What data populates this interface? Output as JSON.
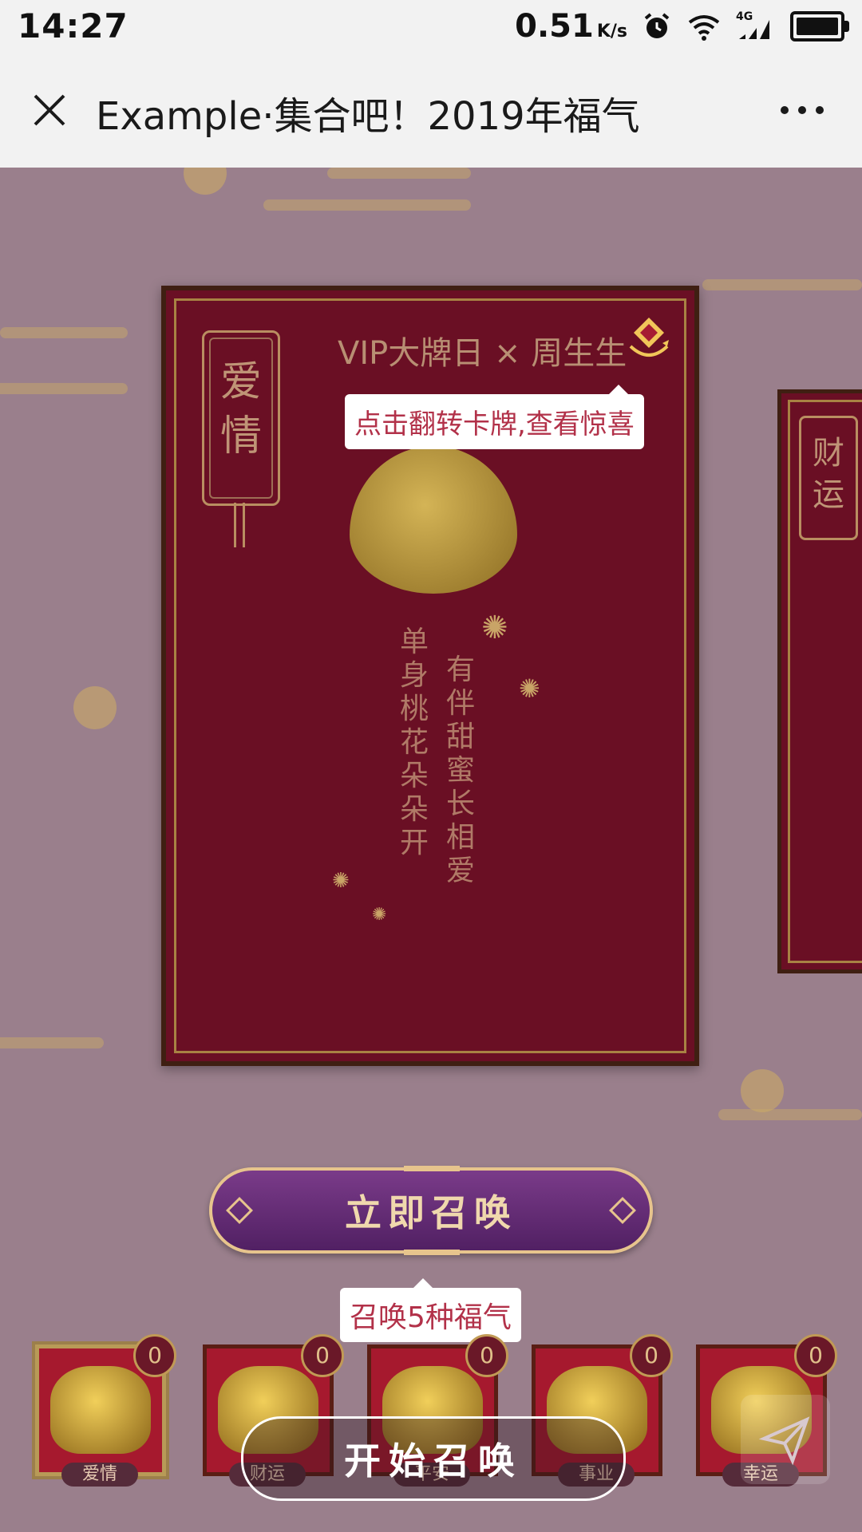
{
  "status_bar": {
    "time": "14:27",
    "net_speed": "0.51",
    "net_unit": "K/s",
    "network_type": "4G",
    "icons": [
      "alarm-icon",
      "wifi-icon",
      "signal-icon",
      "battery-icon"
    ]
  },
  "title_bar": {
    "title": "Example·集合吧！2019年福气",
    "close_icon": "close-icon",
    "more_icon": "more-icon"
  },
  "main_card": {
    "tag": "爱情",
    "brand": "VIP大牌日 × 周生生",
    "flip_tooltip": "点击翻转卡牌,查看惊喜",
    "verse_left": "单身桃花朵朵开",
    "verse_right": "有伴甜蜜长相爱",
    "colors": {
      "card": "#6a0f24",
      "gold": "#a88243"
    }
  },
  "side_card": {
    "tag": "财运"
  },
  "summon_button": {
    "label": "立即召唤"
  },
  "summon_tooltip": "召唤5种福气",
  "cards": [
    {
      "label": "爱情",
      "count": "0",
      "icon": "heart-charm-icon",
      "selected": true
    },
    {
      "label": "财运",
      "count": "0",
      "icon": "lucky-cat-icon",
      "selected": false
    },
    {
      "label": "平安",
      "count": "0",
      "icon": "apple-icon",
      "selected": false
    },
    {
      "label": "事业",
      "count": "0",
      "icon": "dragon-ball-icon",
      "selected": false
    },
    {
      "label": "幸运",
      "count": "0",
      "icon": "gold-ingot-icon",
      "selected": false
    }
  ],
  "start_button": {
    "label": "开始召唤"
  },
  "share_icon": "send-icon"
}
